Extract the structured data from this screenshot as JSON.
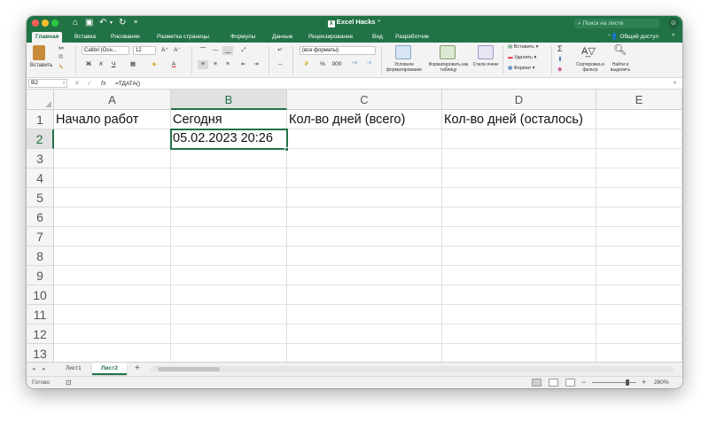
{
  "window": {
    "title": "Excel Hacks",
    "search_placeholder": "Поиск на листе"
  },
  "tabs": [
    {
      "label": "Главная"
    },
    {
      "label": "Вставка"
    },
    {
      "label": "Рисование"
    },
    {
      "label": "Разметка страницы"
    },
    {
      "label": "Формулы"
    },
    {
      "label": "Данные"
    },
    {
      "label": "Рецензирование"
    },
    {
      "label": "Вид"
    },
    {
      "label": "Разработчик"
    }
  ],
  "share_label": "Общий доступ",
  "ribbon": {
    "paste_label": "Вставить",
    "font_name": "Calibri (Осн...",
    "font_size": "12",
    "bold": "Ж",
    "italic": "К",
    "underline": "Ч",
    "number_format": "(все форматы)",
    "percent": "%",
    "thousands": "000",
    "conditional_format": "Условное форматирование",
    "format_as_table": "Форматировать как таблицу",
    "cell_styles": "Стили ячеек",
    "insert": "Вставить",
    "delete": "Удалить",
    "format": "Формат",
    "sort_filter": "Сортировка и фильтр",
    "find_select": "Найти и выделить"
  },
  "formula_bar": {
    "name_box": "B2",
    "fx": "fx",
    "formula": "=ТДАТА()"
  },
  "grid": {
    "columns": [
      "A",
      "B",
      "C",
      "D",
      "E"
    ],
    "selected_column": "B",
    "rows": [
      "1",
      "2",
      "3",
      "4",
      "5",
      "6",
      "7",
      "8",
      "9",
      "10",
      "11",
      "12",
      "13"
    ],
    "selected_row": "2",
    "cells": {
      "A1": "Начало работ",
      "B1": "Сегодня",
      "C1": "Кол-во дней (всего)",
      "D1": "Кол-во дней (осталось)",
      "B2": "05.02.2023 20:26"
    }
  },
  "sheets": [
    {
      "label": "Лист1",
      "active": false
    },
    {
      "label": "Лист2",
      "active": true
    }
  ],
  "status": {
    "ready": "Готово",
    "zoom": "260%"
  },
  "colors": {
    "accent": "#217346",
    "close": "#fe5f57",
    "minimize": "#febc2e",
    "maximize": "#28c840"
  }
}
